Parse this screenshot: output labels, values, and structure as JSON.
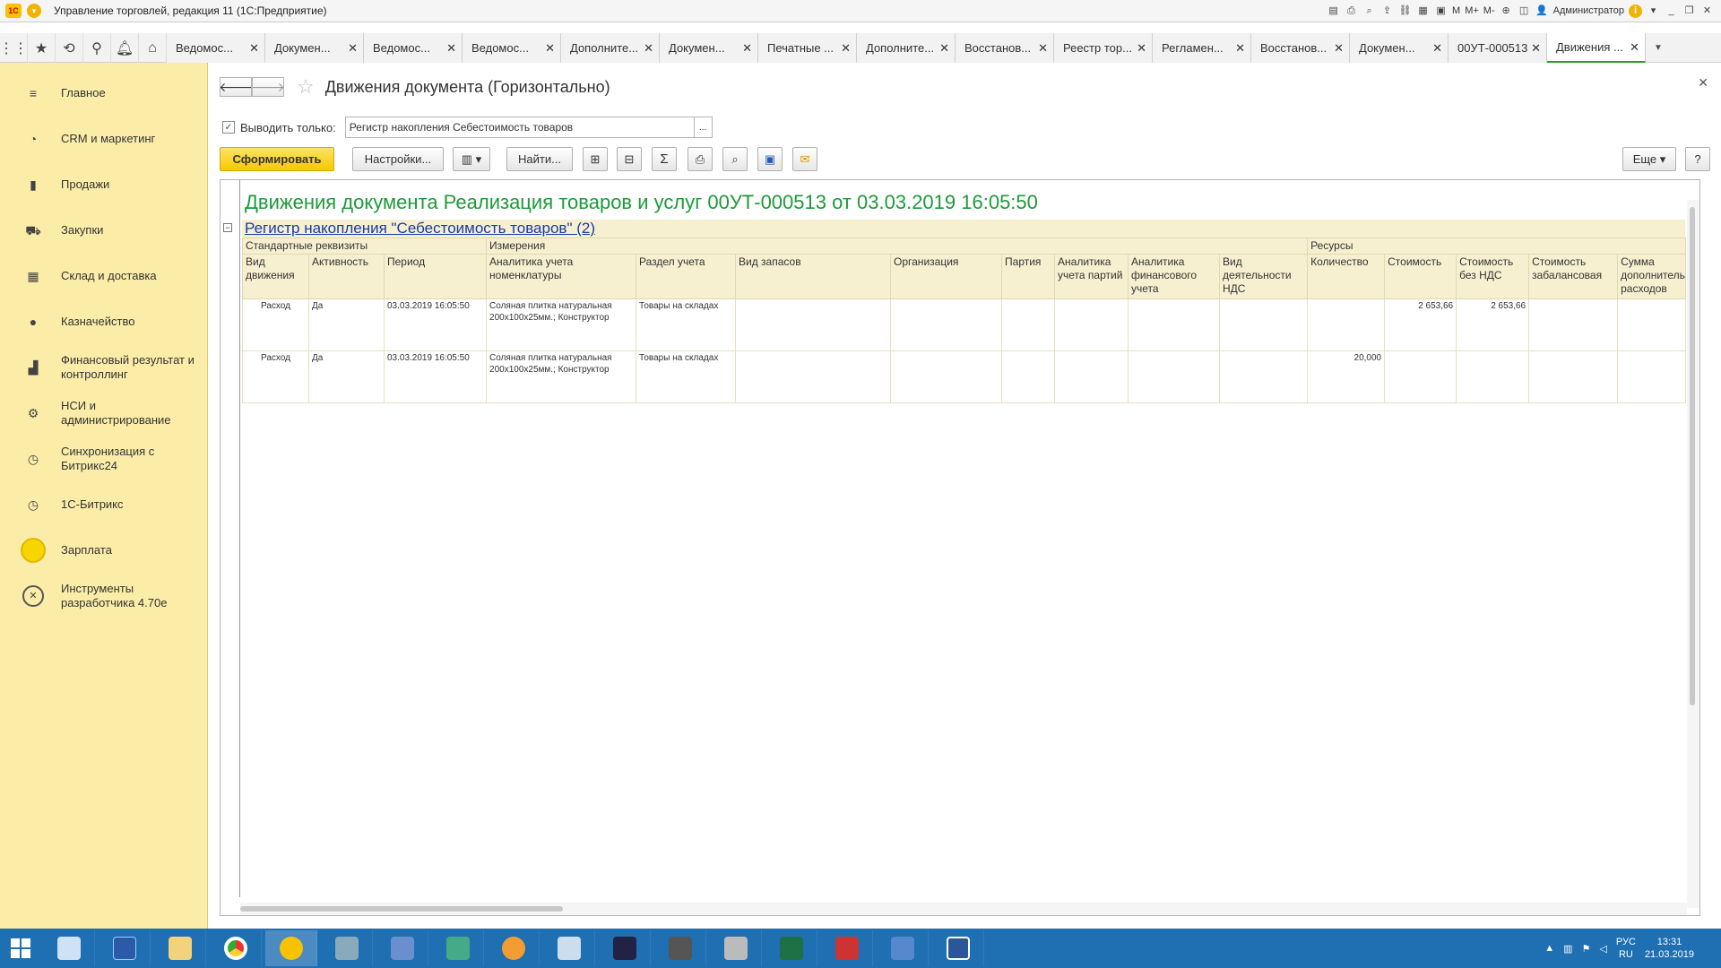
{
  "window": {
    "title": "Управление торговлей, редакция 11  (1С:Предприятие)",
    "user": "Администратор",
    "m_labels": [
      "M",
      "M+",
      "M-"
    ]
  },
  "tabs": [
    {
      "label": "Ведомос..."
    },
    {
      "label": "Докумен..."
    },
    {
      "label": "Ведомос..."
    },
    {
      "label": "Ведомос..."
    },
    {
      "label": "Дополните..."
    },
    {
      "label": "Докумен..."
    },
    {
      "label": "Печатные ..."
    },
    {
      "label": "Дополните..."
    },
    {
      "label": "Восстанов..."
    },
    {
      "label": "Реестр тор..."
    },
    {
      "label": "Регламен..."
    },
    {
      "label": "Восстанов..."
    },
    {
      "label": "Докумен..."
    },
    {
      "label": "00УТ-000513"
    },
    {
      "label": "Движения ..."
    }
  ],
  "sidebar": {
    "items": [
      {
        "label": "Главное",
        "icon": "menu-icon"
      },
      {
        "label": "CRM и маркетинг",
        "icon": "crm-icon"
      },
      {
        "label": "Продажи",
        "icon": "bag-icon"
      },
      {
        "label": "Закупки",
        "icon": "cart-icon"
      },
      {
        "label": "Склад и доставка",
        "icon": "warehouse-icon"
      },
      {
        "label": "Казначейство",
        "icon": "treasury-icon"
      },
      {
        "label": "Финансовый результат и контроллинг",
        "icon": "chart-icon"
      },
      {
        "label": "НСИ и администрирование",
        "icon": "gear-icon"
      },
      {
        "label": "Синхронизация с Битрикс24",
        "icon": "sync-icon"
      },
      {
        "label": "1С-Битрикс",
        "icon": "bitrix-icon"
      },
      {
        "label": "Зарплата",
        "icon": "salary-icon"
      },
      {
        "label": "Инструменты разработчика 4.70е",
        "icon": "tools-icon"
      }
    ]
  },
  "page": {
    "title": "Движения документа (Горизонтально)",
    "filter_label": "Выводить только:",
    "filter_value": "Регистр накопления Себестоимость товаров",
    "filter_dots": "...",
    "btn_generate": "Сформировать",
    "btn_settings": "Настройки...",
    "btn_find": "Найти...",
    "btn_more": "Еще",
    "btn_help": "?"
  },
  "report": {
    "title": "Движения документа Реализация товаров и услуг 00УТ-000513 от 03.03.2019 16:05:50",
    "register": "Регистр накопления \"Себестоимость товаров\" (2)",
    "groups": [
      "Стандартные реквизиты",
      "Измерения",
      "Ресурсы"
    ],
    "columns": [
      "Вид движения",
      "Активность",
      "Период",
      "Аналитика учета номенклатуры",
      "Раздел учета",
      "Вид запасов",
      "Организация",
      "Партия",
      "Аналитика учета партий",
      "Аналитика финансового учета",
      "Вид деятельности НДС",
      "Количество",
      "Стоимость",
      "Стоимость без НДС",
      "Стоимость забалансовая",
      "Сумма дополнительных расходов"
    ],
    "rows": [
      [
        "Расход",
        "Да",
        "03.03.2019 16:05:50",
        "Соляная плитка натуральная 200х100х25мм.; Конструктор",
        "Товары на складах",
        "",
        "",
        "",
        "",
        "",
        "",
        "",
        "2 653,66",
        "2 653,66",
        "",
        ""
      ],
      [
        "Расход",
        "Да",
        "03.03.2019 16:05:50",
        "Соляная плитка натуральная 200х100х25мм.; Конструктор",
        "Товары на складах",
        "",
        "",
        "",
        "",
        "",
        "",
        "20,000",
        "",
        "",
        "",
        ""
      ]
    ]
  },
  "tray": {
    "lang": "РУС",
    "lang2": "RU",
    "time": "13:31",
    "date": "21.03.2019"
  }
}
